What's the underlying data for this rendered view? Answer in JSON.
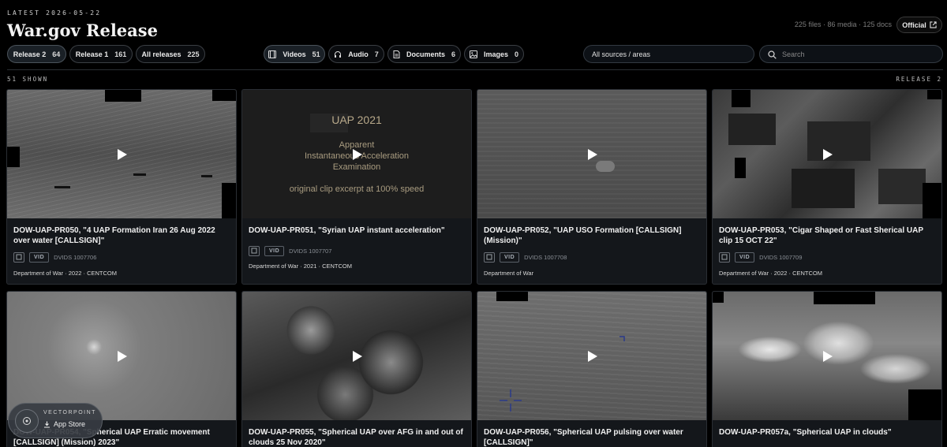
{
  "header": {
    "latest": "LATEST  2026-05-22",
    "title": "War.gov Release",
    "stats": "225 files · 86 media · 125 docs",
    "official_label": "Official"
  },
  "release_filters": [
    {
      "label": "Release 2",
      "count": "64",
      "active": true
    },
    {
      "label": "Release 1",
      "count": "161",
      "active": false
    },
    {
      "label": "All releases",
      "count": "225",
      "active": false
    }
  ],
  "type_filters": [
    {
      "label": "Videos",
      "count": "51",
      "icon": "film-icon",
      "active": true
    },
    {
      "label": "Audio",
      "count": "7",
      "icon": "headphones-icon",
      "active": false
    },
    {
      "label": "Documents",
      "count": "6",
      "icon": "document-icon",
      "active": false
    },
    {
      "label": "Images",
      "count": "0",
      "icon": "image-icon",
      "active": false
    }
  ],
  "source_select": {
    "value": "All sources / areas"
  },
  "search": {
    "placeholder": "Search"
  },
  "results": {
    "shown": "51 SHOWN",
    "release": "RELEASE 2"
  },
  "cards": [
    {
      "title": "DOW-UAP-PR050, \"4 UAP Formation Iran 26 Aug 2022 over water [CALLSIGN]\"",
      "badge": "VID",
      "dvids": "DVIDS 1007706",
      "dept": "Department of War · 2022 · CENTCOM"
    },
    {
      "title": "DOW-UAP-PR051, \"Syrian UAP instant acceleration\"",
      "badge": "VID",
      "dvids": "DVIDS 1007707",
      "dept": "Department of War · 2021 · CENTCOM",
      "overlay": {
        "line1": "UAP 2021",
        "line2": "Apparent",
        "line3": "Instantaneous Acceleration",
        "line4": "Examination",
        "line5": "original clip excerpt at 100% speed"
      }
    },
    {
      "title": "DOW-UAP-PR052, \"UAP USO Formation [CALLSIGN] (Mission)\"",
      "badge": "VID",
      "dvids": "DVIDS 1007708",
      "dept": "Department of War"
    },
    {
      "title": "DOW-UAP-PR053, \"Cigar Shaped or Fast Sherical UAP clip 15 OCT 22\"",
      "badge": "VID",
      "dvids": "DVIDS 1007709",
      "dept": "Department of War · 2022 · CENTCOM"
    },
    {
      "title": "DOW-UAP-PR054, \"Spherical UAP Erratic movement [CALLSIGN] (Mission) 2023\""
    },
    {
      "title": "DOW-UAP-PR055, \"Spherical UAP over AFG in and out of clouds 25 Nov 2020\""
    },
    {
      "title": "DOW-UAP-PR056, \"Spherical UAP pulsing over water [CALLSIGN]\""
    },
    {
      "title": "DOW-UAP-PR057a, \"Spherical UAP in clouds\""
    }
  ],
  "app_badge": {
    "brand": "VECTORPOINT",
    "label": "App Store"
  },
  "colors": {
    "background": "#000000",
    "card": "#14171b",
    "border": "#2a2e34",
    "text": "#f0f0f0"
  }
}
